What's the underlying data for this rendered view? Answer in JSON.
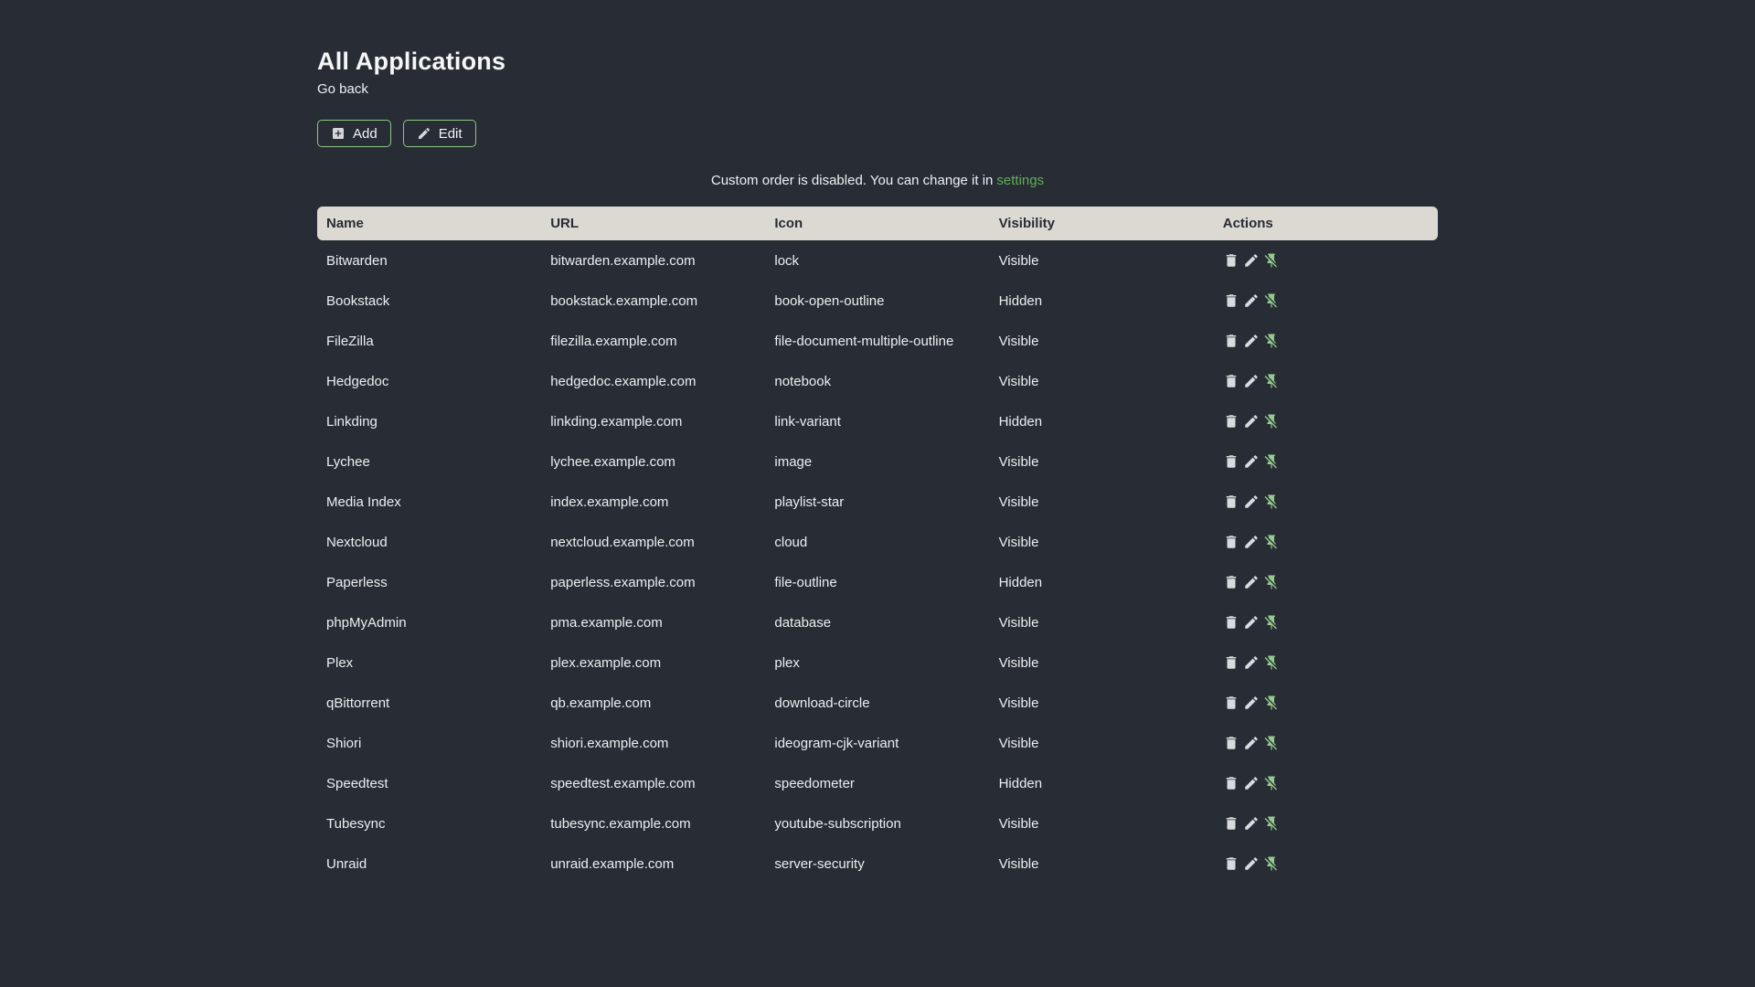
{
  "page": {
    "title": "All Applications",
    "back_link": "Go back"
  },
  "toolbar": {
    "add_label": "Add",
    "edit_label": "Edit"
  },
  "notice": {
    "text": "Custom order is disabled. You can change it in",
    "link_label": "settings"
  },
  "table": {
    "columns": [
      "Name",
      "URL",
      "Icon",
      "Visibility",
      "Actions"
    ],
    "action_icons": [
      "delete-icon",
      "edit-pencil-icon",
      "pin-off-icon"
    ],
    "rows": [
      {
        "name": "Bitwarden",
        "url": "bitwarden.example.com",
        "icon": "lock",
        "visibility": "Visible"
      },
      {
        "name": "Bookstack",
        "url": "bookstack.example.com",
        "icon": "book-open-outline",
        "visibility": "Hidden"
      },
      {
        "name": "FileZilla",
        "url": "filezilla.example.com",
        "icon": "file-document-multiple-outline",
        "visibility": "Visible"
      },
      {
        "name": "Hedgedoc",
        "url": "hedgedoc.example.com",
        "icon": "notebook",
        "visibility": "Visible"
      },
      {
        "name": "Linkding",
        "url": "linkding.example.com",
        "icon": "link-variant",
        "visibility": "Hidden"
      },
      {
        "name": "Lychee",
        "url": "lychee.example.com",
        "icon": "image",
        "visibility": "Visible"
      },
      {
        "name": "Media Index",
        "url": "index.example.com",
        "icon": "playlist-star",
        "visibility": "Visible"
      },
      {
        "name": "Nextcloud",
        "url": "nextcloud.example.com",
        "icon": "cloud",
        "visibility": "Visible"
      },
      {
        "name": "Paperless",
        "url": "paperless.example.com",
        "icon": "file-outline",
        "visibility": "Hidden"
      },
      {
        "name": "phpMyAdmin",
        "url": "pma.example.com",
        "icon": "database",
        "visibility": "Visible"
      },
      {
        "name": "Plex",
        "url": "plex.example.com",
        "icon": "plex",
        "visibility": "Visible"
      },
      {
        "name": "qBittorrent",
        "url": "qb.example.com",
        "icon": "download-circle",
        "visibility": "Visible"
      },
      {
        "name": "Shiori",
        "url": "shiori.example.com",
        "icon": "ideogram-cjk-variant",
        "visibility": "Visible"
      },
      {
        "name": "Speedtest",
        "url": "speedtest.example.com",
        "icon": "speedometer",
        "visibility": "Hidden"
      },
      {
        "name": "Tubesync",
        "url": "tubesync.example.com",
        "icon": "youtube-subscription",
        "visibility": "Visible"
      },
      {
        "name": "Unraid",
        "url": "unraid.example.com",
        "icon": "server-security",
        "visibility": "Visible"
      }
    ]
  },
  "colors": {
    "background": "#272c35",
    "accent_green_link": "#64ad5a",
    "button_border_green": "#8fc786",
    "pin_icon_green": "#95ca8d",
    "table_header_bg": "#dcd9d3",
    "table_header_text": "#272c35",
    "body_text": "#eff1f3"
  }
}
